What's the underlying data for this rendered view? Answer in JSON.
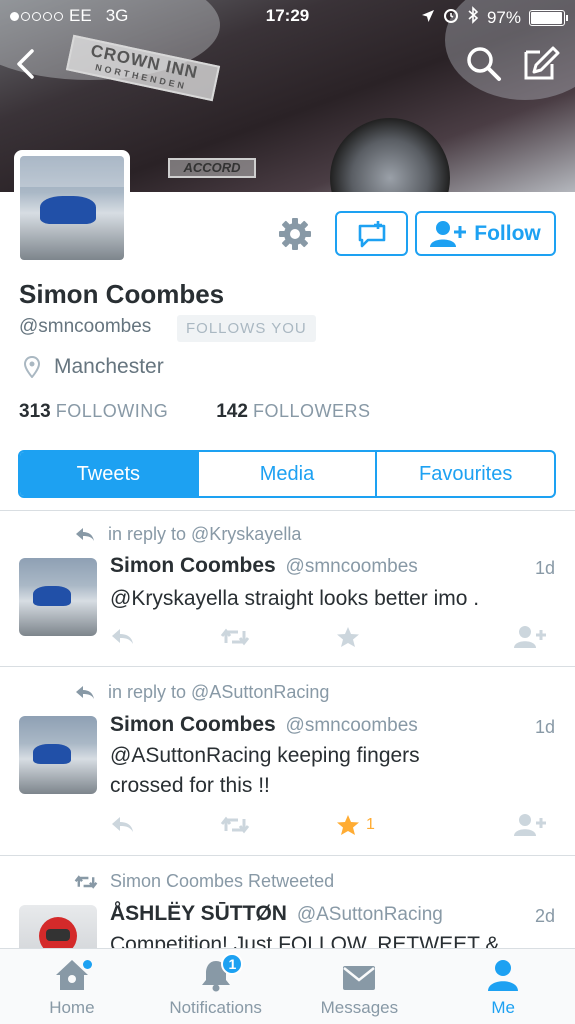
{
  "status_bar": {
    "carrier": "EE",
    "network": "3G",
    "time": "17:29",
    "battery": "97%",
    "battery_level": 0.97,
    "signal_bars_filled": 1,
    "signal_bars_total": 5
  },
  "header": {
    "sticker_text": "CROWN INN",
    "sticker_subtext": "NORTHENDEN",
    "car_badge": "ACCORD"
  },
  "profile": {
    "name": "Simon Coombes",
    "handle": "@smncoombes",
    "follows_you": "FOLLOWS YOU",
    "location": "Manchester",
    "following_count": "313",
    "following_label": "FOLLOWING",
    "followers_count": "142",
    "followers_label": "FOLLOWERS",
    "follow_button": "Follow"
  },
  "tabs": [
    {
      "label": "Tweets",
      "active": true
    },
    {
      "label": "Media",
      "active": false
    },
    {
      "label": "Favourites",
      "active": false
    }
  ],
  "tweets": [
    {
      "context": "in reply to @Kryskayella",
      "author": "Simon Coombes",
      "handle": "@smncoombes",
      "time": "1d",
      "text": "@Kryskayella straight looks better imo .",
      "fav_count": ""
    },
    {
      "context": "in reply to @ASuttonRacing",
      "author": "Simon Coombes",
      "handle": "@smncoombes",
      "time": "1d",
      "text": "@ASuttonRacing keeping fingers crossed for this !!",
      "fav_count": "1"
    },
    {
      "context": "Simon Coombes Retweeted",
      "author": "ÅSHLËY SŪTTØN",
      "handle": "@ASuttonRacing",
      "time": "2d",
      "text": "Competition! Just FOLLOW, RETWEET &"
    }
  ],
  "tabbar": {
    "home": "Home",
    "notifications": "Notifications",
    "notifications_badge": "1",
    "messages": "Messages",
    "me": "Me"
  },
  "colors": {
    "accent": "#1da1f2",
    "favourite": "#ffac33",
    "muted": "#8899a6"
  }
}
